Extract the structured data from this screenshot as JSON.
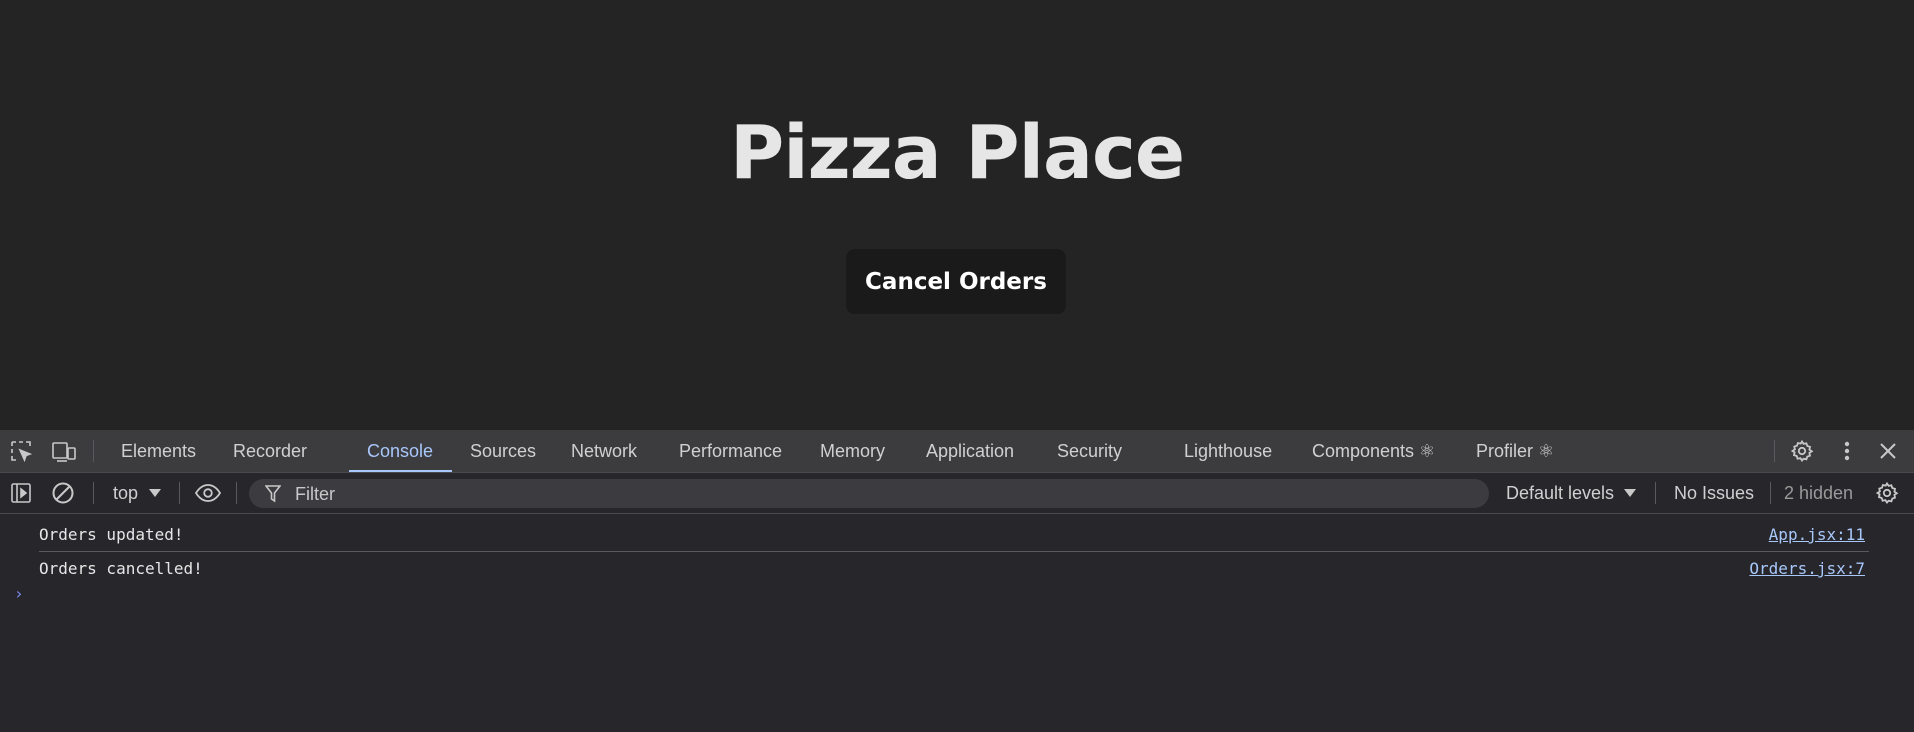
{
  "page": {
    "title": "Pizza Place",
    "cancel_button": "Cancel Orders"
  },
  "devtools": {
    "tabs": [
      {
        "label": "Elements"
      },
      {
        "label": "Recorder"
      },
      {
        "label": "Console"
      },
      {
        "label": "Sources"
      },
      {
        "label": "Network"
      },
      {
        "label": "Performance"
      },
      {
        "label": "Memory"
      },
      {
        "label": "Application"
      },
      {
        "label": "Security"
      },
      {
        "label": "Lighthouse"
      },
      {
        "label": "Components ⚛"
      },
      {
        "label": "Profiler ⚛"
      }
    ],
    "active_tab": "Console",
    "toolbar": {
      "context": "top",
      "filter_placeholder": "Filter",
      "levels": "Default levels",
      "issues": "No Issues",
      "hidden": "2 hidden"
    },
    "console_logs": [
      {
        "message": "Orders updated!",
        "source": "App.jsx:11"
      },
      {
        "message": "Orders cancelled!",
        "source": "Orders.jsx:7"
      }
    ],
    "prompt_symbol": "›"
  },
  "colors": {
    "accent": "#a8c7fa",
    "background": "#242424",
    "devtools_bg": "#27272b"
  },
  "icons": [
    "inspect-element-icon",
    "device-toggle-icon",
    "settings-gear-icon",
    "more-vertical-icon",
    "close-icon",
    "sidebar-toggle-icon",
    "clear-console-icon",
    "dropdown-arrow-icon",
    "eye-icon",
    "filter-icon"
  ]
}
